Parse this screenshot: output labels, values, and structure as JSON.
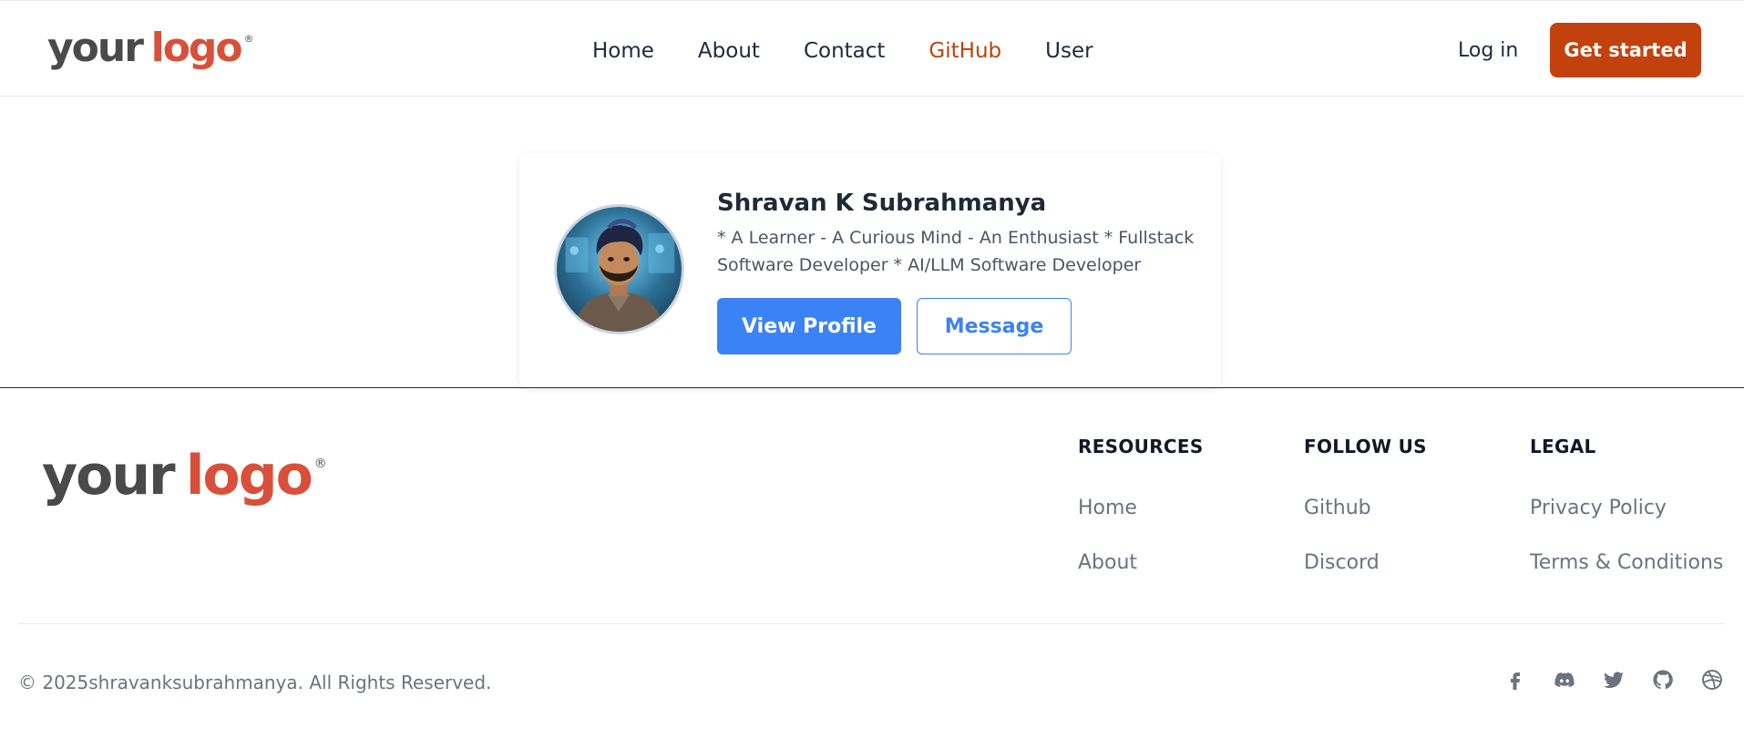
{
  "header": {
    "logo": {
      "word1": "your",
      "word2": "logo",
      "mark": "®"
    },
    "nav": [
      {
        "label": "Home"
      },
      {
        "label": "About"
      },
      {
        "label": "Contact"
      },
      {
        "label": "GitHub",
        "active": true
      },
      {
        "label": "User"
      }
    ],
    "login_label": "Log in",
    "cta_label": "Get started"
  },
  "profile": {
    "name": "Shravan K Subrahmanya",
    "bio": "* A Learner - A Curious Mind - An Enthusiast * Fullstack Software Developer * AI/LLM Software Developer",
    "view_label": "View Profile",
    "message_label": "Message"
  },
  "footer": {
    "logo": {
      "word1": "your",
      "word2": "logo",
      "mark": "®"
    },
    "columns": [
      {
        "title": "RESOURCES",
        "links": [
          "Home",
          "About"
        ]
      },
      {
        "title": "FOLLOW US",
        "links": [
          "Github",
          "Discord"
        ]
      },
      {
        "title": "LEGAL",
        "links": [
          "Privacy Policy",
          "Terms & Conditions"
        ]
      }
    ],
    "copyright": "© 2025shravanksubrahmanya. All Rights Reserved.",
    "social_icons": [
      "facebook-icon",
      "discord-icon",
      "twitter-icon",
      "github-icon",
      "dribbble-icon"
    ]
  },
  "colors": {
    "accent": "#c2410c",
    "primary_blue": "#3b82f6",
    "logo_red": "#d9503a",
    "logo_gray": "#4a4a4a"
  }
}
